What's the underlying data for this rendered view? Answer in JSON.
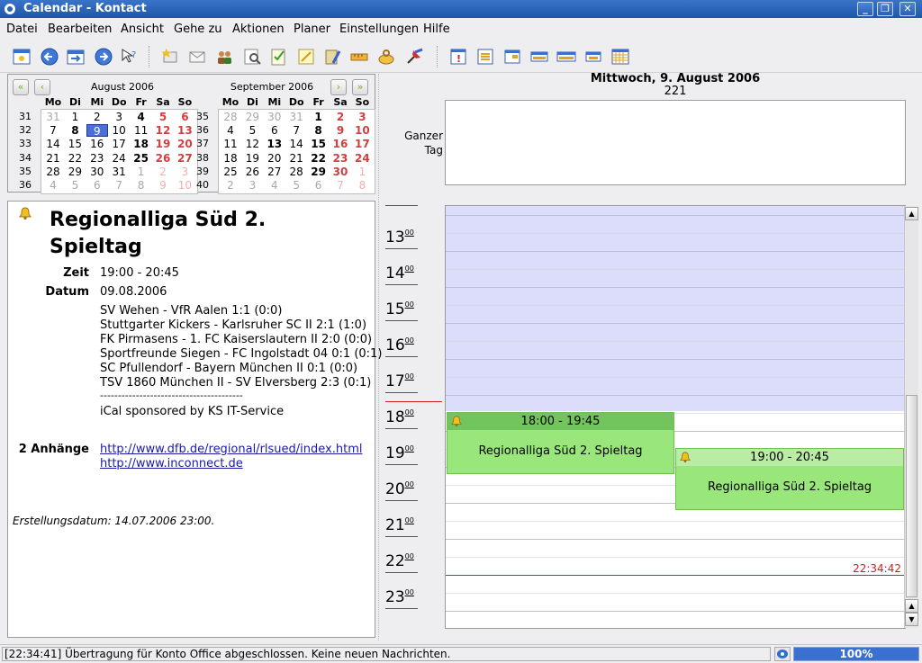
{
  "window": {
    "title": "Calendar - Kontact"
  },
  "menu": [
    "Datei",
    "Bearbeiten",
    "Ansicht",
    "Gehe zu",
    "Aktionen",
    "Planer",
    "Einstellungen",
    "Hilfe"
  ],
  "toolbar_icons": [
    "new-event-icon",
    "back-icon",
    "today-icon",
    "forward-icon",
    "whats-this-icon",
    "new-item-icon",
    "mail-icon",
    "contacts-icon",
    "search-icon",
    "todo-icon",
    "note-icon",
    "journal-icon",
    "ruler-icon",
    "pot-icon",
    "pin-icon",
    "whats-next-icon",
    "list-view-icon",
    "day-view-icon",
    "work-week-icon",
    "week-view-icon",
    "next-days-icon",
    "month-view-icon"
  ],
  "minical": {
    "august": {
      "title": "August 2006",
      "dow": [
        "Mo",
        "Di",
        "Mi",
        "Do",
        "Fr",
        "Sa",
        "So"
      ],
      "weeks": [
        "31",
        "32",
        "33",
        "34",
        "35",
        "36"
      ],
      "days": [
        [
          "31",
          "1",
          "2",
          "3",
          "4",
          "5",
          "6"
        ],
        [
          "7",
          "8",
          "9",
          "10",
          "11",
          "12",
          "13"
        ],
        [
          "14",
          "15",
          "16",
          "17",
          "18",
          "19",
          "20"
        ],
        [
          "21",
          "22",
          "23",
          "24",
          "25",
          "26",
          "27"
        ],
        [
          "28",
          "29",
          "30",
          "31",
          "1",
          "2",
          "3"
        ],
        [
          "4",
          "5",
          "6",
          "7",
          "8",
          "9",
          "10"
        ]
      ]
    },
    "september": {
      "title": "September 2006",
      "dow": [
        "Mo",
        "Di",
        "Mi",
        "Do",
        "Fr",
        "Sa",
        "So"
      ],
      "weeks": [
        "35",
        "36",
        "37",
        "38",
        "39",
        "40"
      ],
      "days": [
        [
          "28",
          "29",
          "30",
          "31",
          "1",
          "2",
          "3"
        ],
        [
          "4",
          "5",
          "6",
          "7",
          "8",
          "9",
          "10"
        ],
        [
          "11",
          "12",
          "13",
          "14",
          "15",
          "16",
          "17"
        ],
        [
          "18",
          "19",
          "20",
          "21",
          "22",
          "23",
          "24"
        ],
        [
          "25",
          "26",
          "27",
          "28",
          "29",
          "30",
          "1"
        ],
        [
          "2",
          "3",
          "4",
          "5",
          "6",
          "7",
          "8"
        ]
      ]
    }
  },
  "detail": {
    "title": "Regionalliga Süd 2. Spieltag",
    "zeit_label": "Zeit",
    "zeit": "19:00 - 20:45",
    "datum_label": "Datum",
    "datum": "09.08.2006",
    "lines": [
      "SV Wehen - VfR Aalen 1:1 (0:0)",
      "Stuttgarter Kickers - Karlsruher SC II 2:1 (1:0)",
      "FK Pirmasens - 1. FC Kaiserslautern II 2:0 (0:0)",
      "Sportfreunde Siegen - FC Ingolstadt 04 0:1 (0:1)",
      "SC Pfullendorf - Bayern München II 0:1 (0:0)",
      "TSV 1860 München II - SV Elversberg 2:3 (0:1)",
      "----------------------------------------",
      "iCal sponsored by KS IT-Service"
    ],
    "attachments_label": "2 Anhänge",
    "attachments": [
      "http://www.dfb.de/regional/rlsued/index.html",
      "http://www.inconnect.de"
    ],
    "created": "Erstellungsdatum: 14.07.2006 23:00."
  },
  "day": {
    "header": "Mittwoch, 9. August 2006",
    "daynum": "221",
    "allday_label": [
      "Ganzer",
      "Tag"
    ],
    "hours": [
      "13",
      "14",
      "15",
      "16",
      "17",
      "18",
      "19",
      "20",
      "21",
      "22",
      "23"
    ],
    "minutes": "00",
    "current_time": "22:34:42",
    "events": [
      {
        "time": "18:00 - 19:45",
        "title": "Regionalliga Süd 2. Spieltag"
      },
      {
        "time": "19:00 - 20:45",
        "title": "Regionalliga Süd 2. Spieltag"
      }
    ]
  },
  "status": {
    "message": "[22:34:41] Übertragung für Konto Office abgeschlossen. Keine neuen Nachrichten.",
    "progress": "100%"
  },
  "colors": {
    "title_bar": "#2a62b8",
    "event": "#99e67a",
    "event_header": "#72c45c",
    "offhours": "#dcdcfb",
    "weekend": "#d23f3f",
    "now_line": "#cc2222"
  }
}
